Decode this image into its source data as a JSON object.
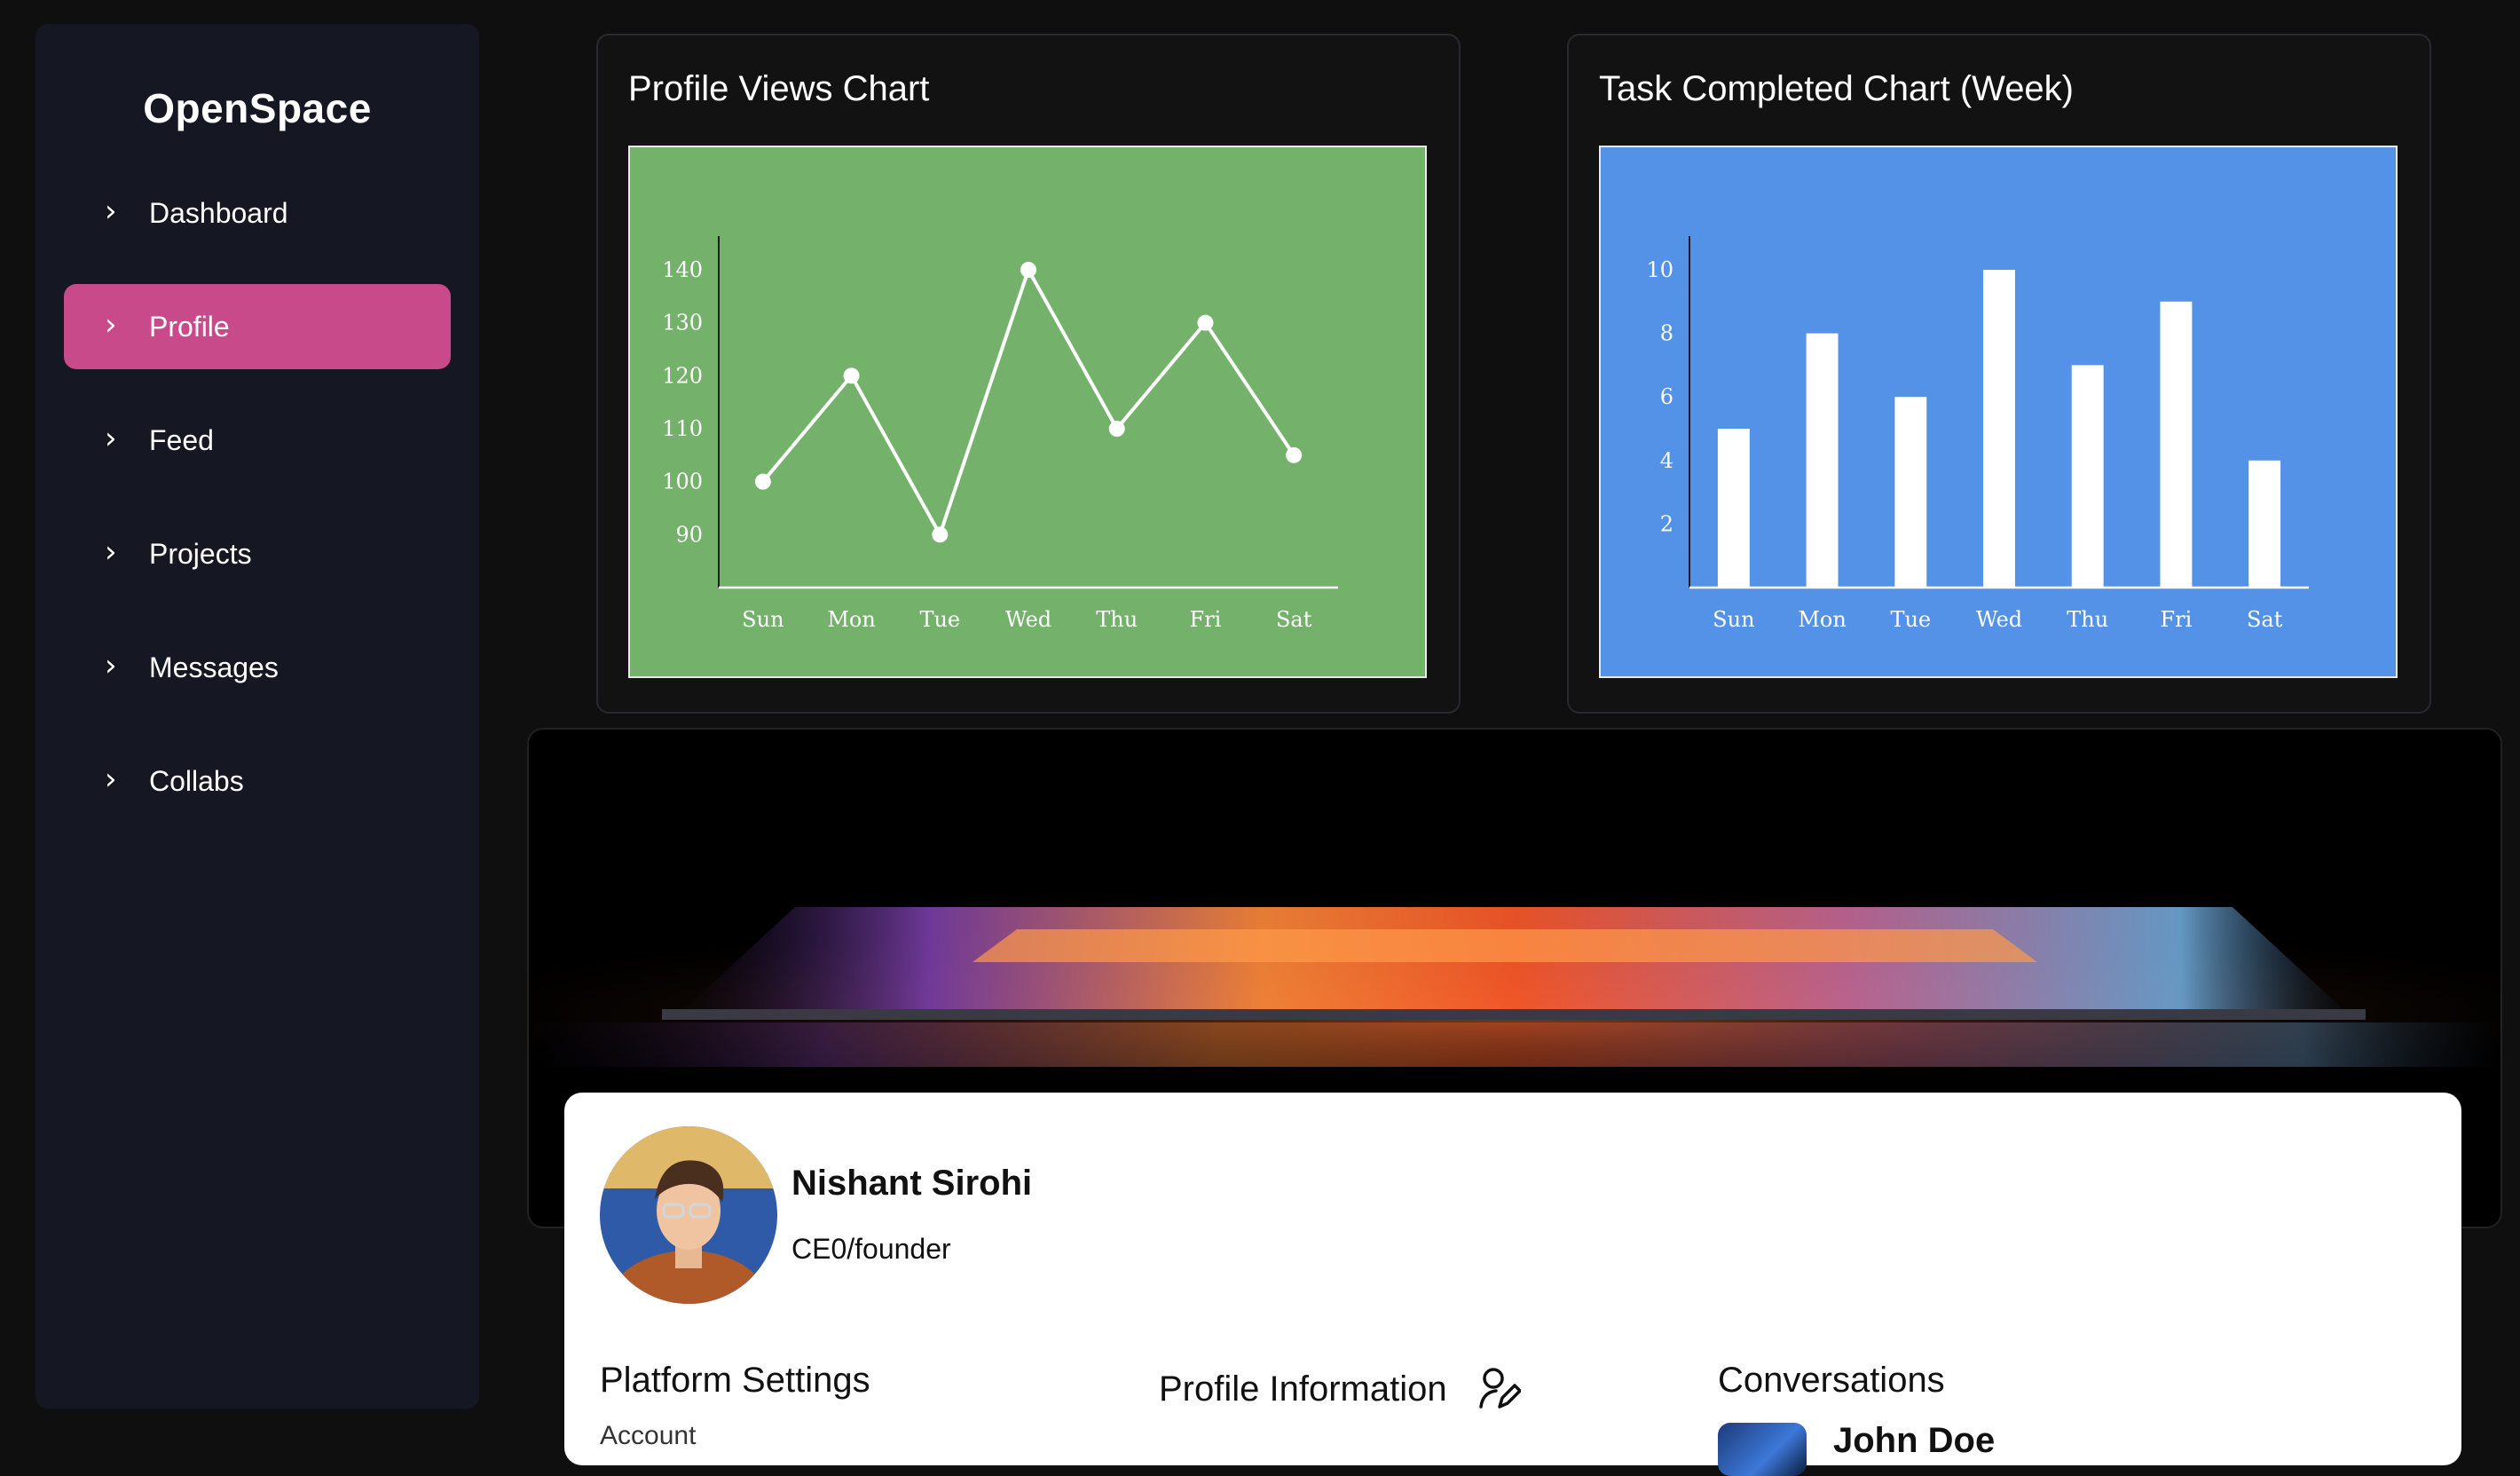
{
  "app": {
    "brand": "OpenSpace"
  },
  "sidebar": {
    "items": [
      {
        "label": "Dashboard",
        "active": false
      },
      {
        "label": "Profile",
        "active": true
      },
      {
        "label": "Feed",
        "active": false
      },
      {
        "label": "Projects",
        "active": false
      },
      {
        "label": "Messages",
        "active": false
      },
      {
        "label": "Collabs",
        "active": false
      }
    ],
    "chevron": "›"
  },
  "colors": {
    "active_nav": "#c94a8a",
    "views_chart_bg": "#74b16b",
    "tasks_chart_bg": "#5392e6"
  },
  "chart_data": [
    {
      "type": "line",
      "title": "Profile Views Chart",
      "categories": [
        "Sun",
        "Mon",
        "Tue",
        "Wed",
        "Thu",
        "Fri",
        "Sat"
      ],
      "values": [
        100,
        120,
        90,
        140,
        110,
        130,
        105
      ],
      "yticks": [
        90,
        100,
        110,
        120,
        130,
        140
      ],
      "ylim": [
        80,
        140
      ],
      "grid": false
    },
    {
      "type": "bar",
      "title": "Task Completed Chart (Week)",
      "categories": [
        "Sun",
        "Mon",
        "Tue",
        "Wed",
        "Thu",
        "Fri",
        "Sat"
      ],
      "values": [
        5,
        8,
        6,
        10,
        7,
        9,
        4
      ],
      "yticks": [
        2,
        4,
        6,
        8,
        10
      ],
      "ylim": [
        0,
        10
      ],
      "grid": false
    }
  ],
  "profile": {
    "name": "Nishant Sirohi",
    "role": "CE0/founder",
    "sections": {
      "settings": "Platform Settings",
      "info": "Profile Information",
      "conversations": "Conversations"
    },
    "settings_first_item": "Account",
    "conversation_first_name": "John Doe"
  }
}
